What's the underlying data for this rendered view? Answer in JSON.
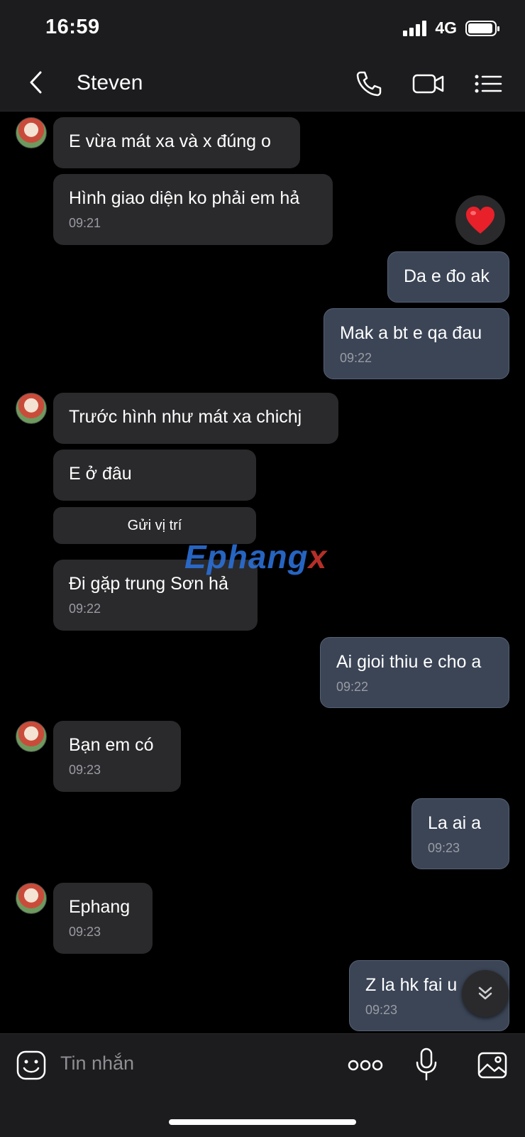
{
  "status_bar": {
    "time": "16:59",
    "network": "4G"
  },
  "header": {
    "contact_name": "Steven"
  },
  "messages": [
    {
      "direction": "in",
      "text": "E vừa mát xa và x đúng o"
    },
    {
      "direction": "in",
      "text": "Hình giao diện ko phải em hả",
      "time": "09:21"
    },
    {
      "direction": "out",
      "text": "Da e đo ak"
    },
    {
      "direction": "out",
      "text": "Mak a bt e qa đau",
      "time": "09:22"
    },
    {
      "direction": "in",
      "text": "Trước hình như mát xa chichj"
    },
    {
      "direction": "in",
      "text": "E ở đâu"
    },
    {
      "direction": "in",
      "text": "Đi gặp trung Sơn hả",
      "time": "09:22"
    },
    {
      "direction": "out",
      "text": "Ai gioi thiu e cho a",
      "time": "09:22"
    },
    {
      "direction": "in",
      "text": "Bạn em có",
      "time": "09:23"
    },
    {
      "direction": "out",
      "text": "La ai a",
      "time": "09:23"
    },
    {
      "direction": "in",
      "text": "Ephang",
      "time": "09:23"
    },
    {
      "direction": "out",
      "text": "Z la hk fai u",
      "time": "09:23"
    }
  ],
  "location_button": "Gửi vị trí",
  "watermark": {
    "part1": "Ephang",
    "part2": "x"
  },
  "composer": {
    "placeholder": "Tin nhắn"
  },
  "colors": {
    "background": "#000000",
    "incoming_bubble": "#2a2a2c",
    "outgoing_bubble": "#3b4556",
    "timestamp": "#9a9ca3",
    "reaction_heart": "#e8202a"
  }
}
